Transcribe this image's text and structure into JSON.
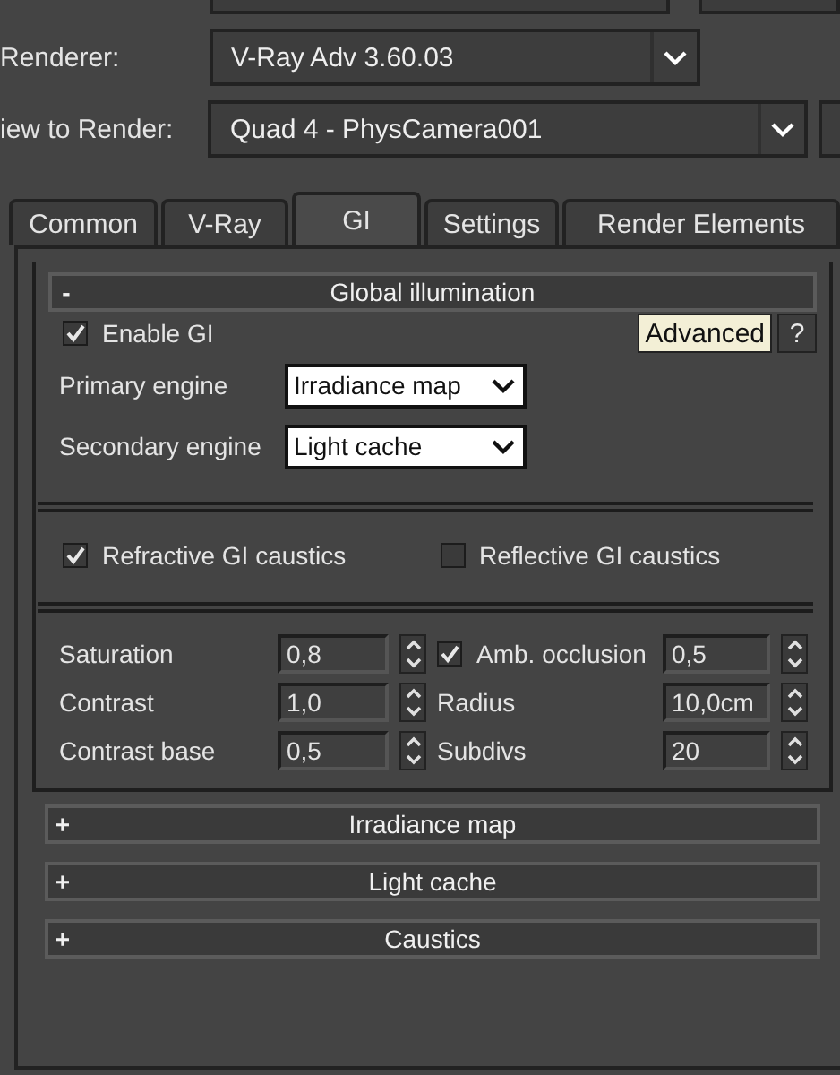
{
  "renderer": {
    "label": "Renderer:",
    "value": "V-Ray Adv 3.60.03"
  },
  "view_to_render": {
    "label": "iew to Render:",
    "value": "Quad 4 - PhysCamera001"
  },
  "tabs": [
    {
      "label": "Common",
      "selected": false
    },
    {
      "label": "V-Ray",
      "selected": false
    },
    {
      "label": "GI",
      "selected": true
    },
    {
      "label": "Settings",
      "selected": false
    },
    {
      "label": "Render Elements",
      "selected": false
    }
  ],
  "rollouts": [
    {
      "toggle": "-",
      "title": "Global illumination",
      "expanded": true
    },
    {
      "toggle": "+",
      "title": "Irradiance map",
      "expanded": false
    },
    {
      "toggle": "+",
      "title": "Light cache",
      "expanded": false
    },
    {
      "toggle": "+",
      "title": "Caustics",
      "expanded": false
    }
  ],
  "global_illumination": {
    "enable_gi": {
      "label": "Enable GI",
      "checked": true
    },
    "advanced_button": "Advanced",
    "help_button": "?",
    "primary_engine": {
      "label": "Primary engine",
      "value": "Irradiance map"
    },
    "secondary_engine": {
      "label": "Secondary engine",
      "value": "Light cache"
    },
    "caustics": [
      {
        "label": "Refractive GI caustics",
        "checked": true
      },
      {
        "label": "Reflective GI caustics",
        "checked": false
      }
    ],
    "left_params": [
      {
        "label": "Saturation",
        "value": "0,8"
      },
      {
        "label": "Contrast",
        "value": "1,0"
      },
      {
        "label": "Contrast base",
        "value": "0,5"
      }
    ],
    "ambient_occlusion": {
      "label": "Amb. occlusion",
      "checked": true,
      "value": "0,5"
    },
    "right_params": [
      {
        "label": "Radius",
        "value": "10,0cm"
      },
      {
        "label": "Subdivs",
        "value": "20"
      }
    ]
  }
}
